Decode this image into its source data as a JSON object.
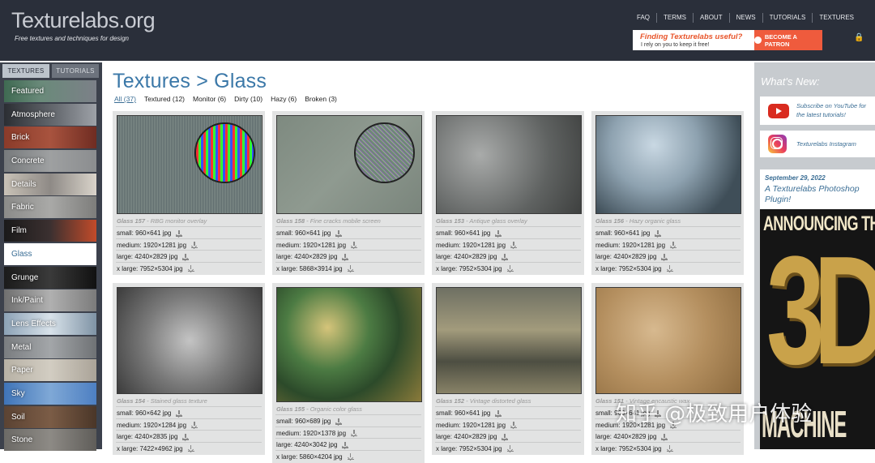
{
  "header": {
    "logo": "Texturelabs.org",
    "tagline": "Free textures and techniques for design",
    "nav": [
      "FAQ",
      "TERMS",
      "ABOUT",
      "NEWS",
      "TUTORIALS",
      "TEXTURES"
    ],
    "patron_title": "Finding Texturelabs useful?",
    "patron_sub": "I rely on you to keep it free!",
    "patron_button": "BECOME A PATRON"
  },
  "sidebar": {
    "tabs": [
      "TEXTURES",
      "TUTORIALS"
    ],
    "items": [
      {
        "label": "Featured",
        "bg": "linear-gradient(90deg,#3f6a52,#6a8a7a 40%,#7c8088)"
      },
      {
        "label": "Atmosphere",
        "bg": "linear-gradient(90deg,#2b2e33,#6b6f75 60%,#9ea2a8)"
      },
      {
        "label": "Brick",
        "bg": "linear-gradient(90deg,#8a3b2a,#a8533e 50%,#6f2c22)"
      },
      {
        "label": "Concrete",
        "bg": "linear-gradient(90deg,#777a7c,#9ea0a1 50%,#8b8d8f)"
      },
      {
        "label": "Details",
        "bg": "linear-gradient(90deg,#c9c2b7,#8e8a86 50%,#d9d3ca)"
      },
      {
        "label": "Fabric",
        "bg": "linear-gradient(90deg,#8b8b89,#a9a9a7 50%,#7d7d7b)"
      },
      {
        "label": "Film",
        "bg": "linear-gradient(90deg,#1a1a1a,#3b3030 50%,#c24b2a)"
      },
      {
        "label": "Glass",
        "bg": "#ffffff"
      },
      {
        "label": "Grunge",
        "bg": "linear-gradient(90deg,#1b1b1b,#3a3a3a 50%,#111)"
      },
      {
        "label": "Ink/Paint",
        "bg": "linear-gradient(90deg,#6f6f6f,#b0b0b0 50%,#7b7b7b)"
      },
      {
        "label": "Lens Effects",
        "bg": "linear-gradient(90deg,#8ca2b6,#d8e2ea 50%,#7f93a5)"
      },
      {
        "label": "Metal",
        "bg": "linear-gradient(90deg,#7a7d80,#a3a6a9 50%,#6f7275)"
      },
      {
        "label": "Paper",
        "bg": "linear-gradient(90deg,#b7b1a5,#d2cdc2 50%,#aaa398)"
      },
      {
        "label": "Sky",
        "bg": "linear-gradient(90deg,#3f74b8,#7fa8d6 50%,#4d7fc2)"
      },
      {
        "label": "Soil",
        "bg": "linear-gradient(90deg,#5b4333,#7b5c46 50%,#4a3628)"
      },
      {
        "label": "Stone",
        "bg": "linear-gradient(90deg,#6c6a66,#8d8a85 50%,#5f5d59)"
      }
    ]
  },
  "main": {
    "title": "Textures > Glass",
    "filters": [
      "All (37)",
      "Textured (12)",
      "Monitor (6)",
      "Dirty (10)",
      "Hazy (6)",
      "Broken (3)"
    ],
    "cards": [
      {
        "id": "Glass 157",
        "name": "RBG monitor overlay",
        "sizes": [
          "small: 960×641 jpg",
          "medium: 1920×1281 jpg",
          "large: 4240×2829 jpg",
          "x large: 7952×5304 jpg"
        ]
      },
      {
        "id": "Glass 158",
        "name": "Fine cracks mobile screen",
        "sizes": [
          "small: 960×641 jpg",
          "medium: 1920×1281 jpg",
          "large: 4240×2829 jpg",
          "x large: 5868×3914 jpg"
        ]
      },
      {
        "id": "Glass 153",
        "name": "Antique glass overlay",
        "sizes": [
          "small: 960×641 jpg",
          "medium: 1920×1281 jpg",
          "large: 4240×2829 jpg",
          "x large: 7952×5304 jpg"
        ]
      },
      {
        "id": "Glass 156",
        "name": "Hazy organic glass",
        "sizes": [
          "small: 960×641 jpg",
          "medium: 1920×1281 jpg",
          "large: 4240×2829 jpg",
          "x large: 7952×5304 jpg"
        ]
      },
      {
        "id": "Glass 154",
        "name": "Stained glass texture",
        "sizes": [
          "small: 960×642 jpg",
          "medium: 1920×1284 jpg",
          "large: 4240×2835 jpg",
          "x large: 7422×4962 jpg"
        ]
      },
      {
        "id": "Glass 155",
        "name": "Organic color glass",
        "sizes": [
          "small: 960×689 jpg",
          "medium: 1920×1378 jpg",
          "large: 4240×3042 jpg",
          "x large: 5860×4204 jpg"
        ]
      },
      {
        "id": "Glass 152",
        "name": "Vintage distorted glass",
        "sizes": [
          "small: 960×641 jpg",
          "medium: 1920×1281 jpg",
          "large: 4240×2829 jpg",
          "x large: 7952×5304 jpg"
        ]
      },
      {
        "id": "Glass 151",
        "name": "Vintage encaustic wax",
        "sizes": [
          "small: 960×641 jpg",
          "medium: 1920×1281 jpg",
          "large: 4240×2829 jpg",
          "x large: 7952×5304 jpg"
        ]
      }
    ]
  },
  "right": {
    "whats_new": "What's New:",
    "youtube": "Subscribe on YouTube for the latest tutorials!",
    "instagram": "Texturelabs Instagram",
    "news_date": "September 29, 2022",
    "news_title": "A Texturelabs Photoshop Plugin!",
    "poster_heading": "ANNOUNCING THE",
    "poster_big": "3D",
    "poster_bottom": "MACHINE"
  },
  "watermark": "知乎 @极致用户体验"
}
